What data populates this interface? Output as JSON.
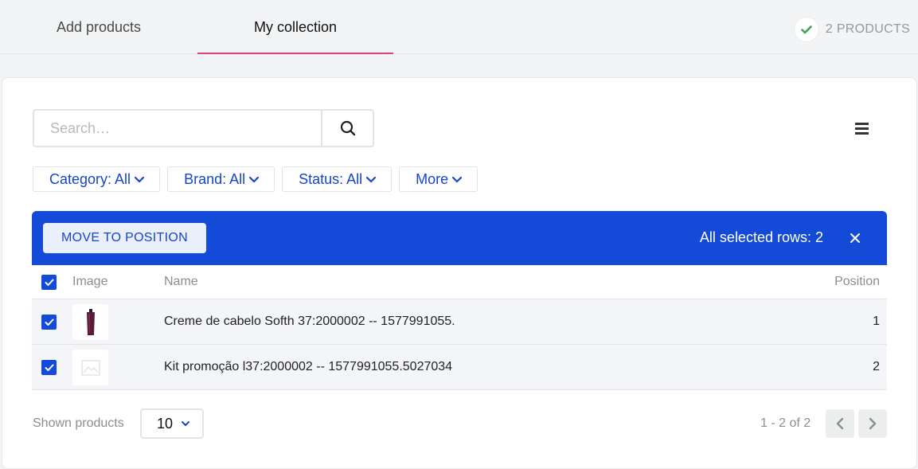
{
  "tabs": {
    "add": "Add products",
    "collection": "My collection"
  },
  "product_count": "2 PRODUCTS",
  "search": {
    "placeholder": "Search…"
  },
  "filters": [
    {
      "label": "Category: All"
    },
    {
      "label": "Brand: All"
    },
    {
      "label": "Status: All"
    },
    {
      "label": "More"
    }
  ],
  "bulk": {
    "move_label": "MOVE TO POSITION",
    "selected_text": "All selected rows: 2"
  },
  "table": {
    "headers": {
      "image": "Image",
      "name": "Name",
      "position": "Position"
    },
    "rows": [
      {
        "name": "Creme de cabelo Softh 37:2000002 -- 1577991055.",
        "position": "1",
        "image": "product-thumbnail",
        "selected": true
      },
      {
        "name": "Kit promoção l37:2000002 -- 1577991055.5027034",
        "position": "2",
        "image": "image-placeholder",
        "selected": true
      }
    ]
  },
  "footer": {
    "shown_label": "Shown products",
    "page_size": "10",
    "page_info": "1 - 2 of 2"
  },
  "colors": {
    "accent": "#134bd8",
    "tab_underline": "#e0407a",
    "success": "#3aa655"
  },
  "icons": [
    "check-icon",
    "search-icon",
    "density-icon",
    "chevron-down-icon",
    "close-icon",
    "chevron-left-icon",
    "chevron-right-icon"
  ]
}
